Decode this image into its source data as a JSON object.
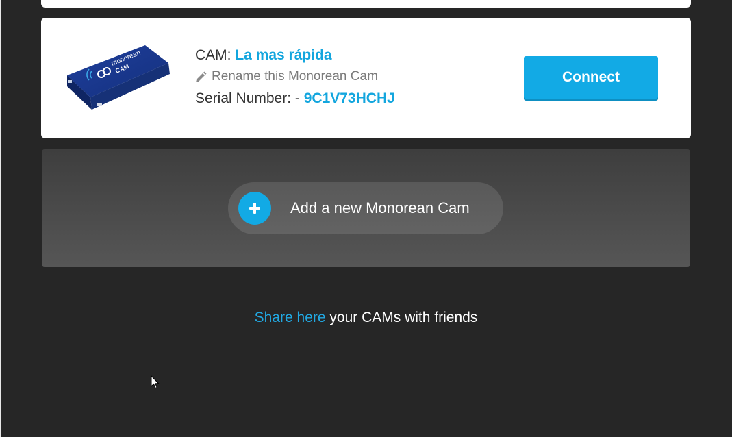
{
  "camera": {
    "label_prefix": "CAM: ",
    "name": "La mas rápida",
    "rename_label": "Rename this Monorean Cam",
    "serial_prefix": "Serial Number: - ",
    "serial_number": "9C1V73HCHJ",
    "device_brand": "monorean",
    "device_model": "CAM",
    "connect_label": "Connect"
  },
  "add_cam": {
    "label": "Add a new Monorean Cam"
  },
  "share": {
    "link_text": "Share here",
    "rest_text": " your CAMs with friends"
  },
  "colors": {
    "background": "#262626",
    "accent": "#12aae5",
    "card": "#ffffff"
  },
  "icons": {
    "rename": "pencil-icon",
    "add": "plus-icon",
    "cursor": "mouse-pointer-icon"
  }
}
